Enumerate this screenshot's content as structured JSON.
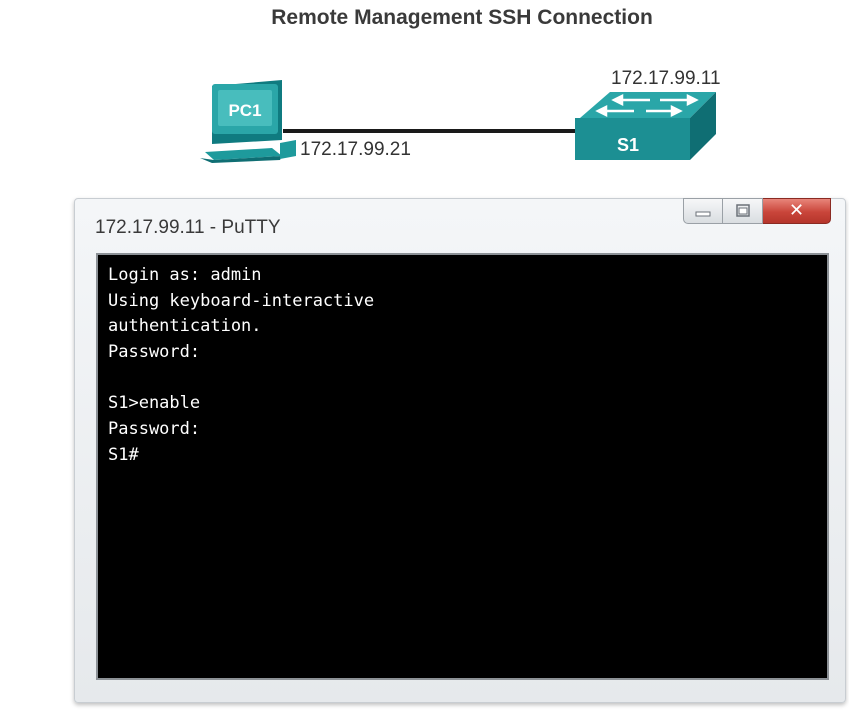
{
  "title": "Remote Management SSH Connection",
  "topology": {
    "pc": {
      "label": "PC1",
      "ip": "172.17.99.21"
    },
    "switch": {
      "label": "S1",
      "ip": "172.17.99.11"
    }
  },
  "putty": {
    "window_title": "172.17.99.11 - PuTTY",
    "terminal_lines": [
      "Login as: admin",
      "Using keyboard-interactive",
      "authentication.",
      "Password:",
      "",
      "S1>enable",
      "Password:",
      "S1#"
    ]
  },
  "colors": {
    "device_teal": "#1e9a9c",
    "close_button": "#c9453a",
    "terminal_bg": "#000000",
    "terminal_text": "#ffffff"
  }
}
